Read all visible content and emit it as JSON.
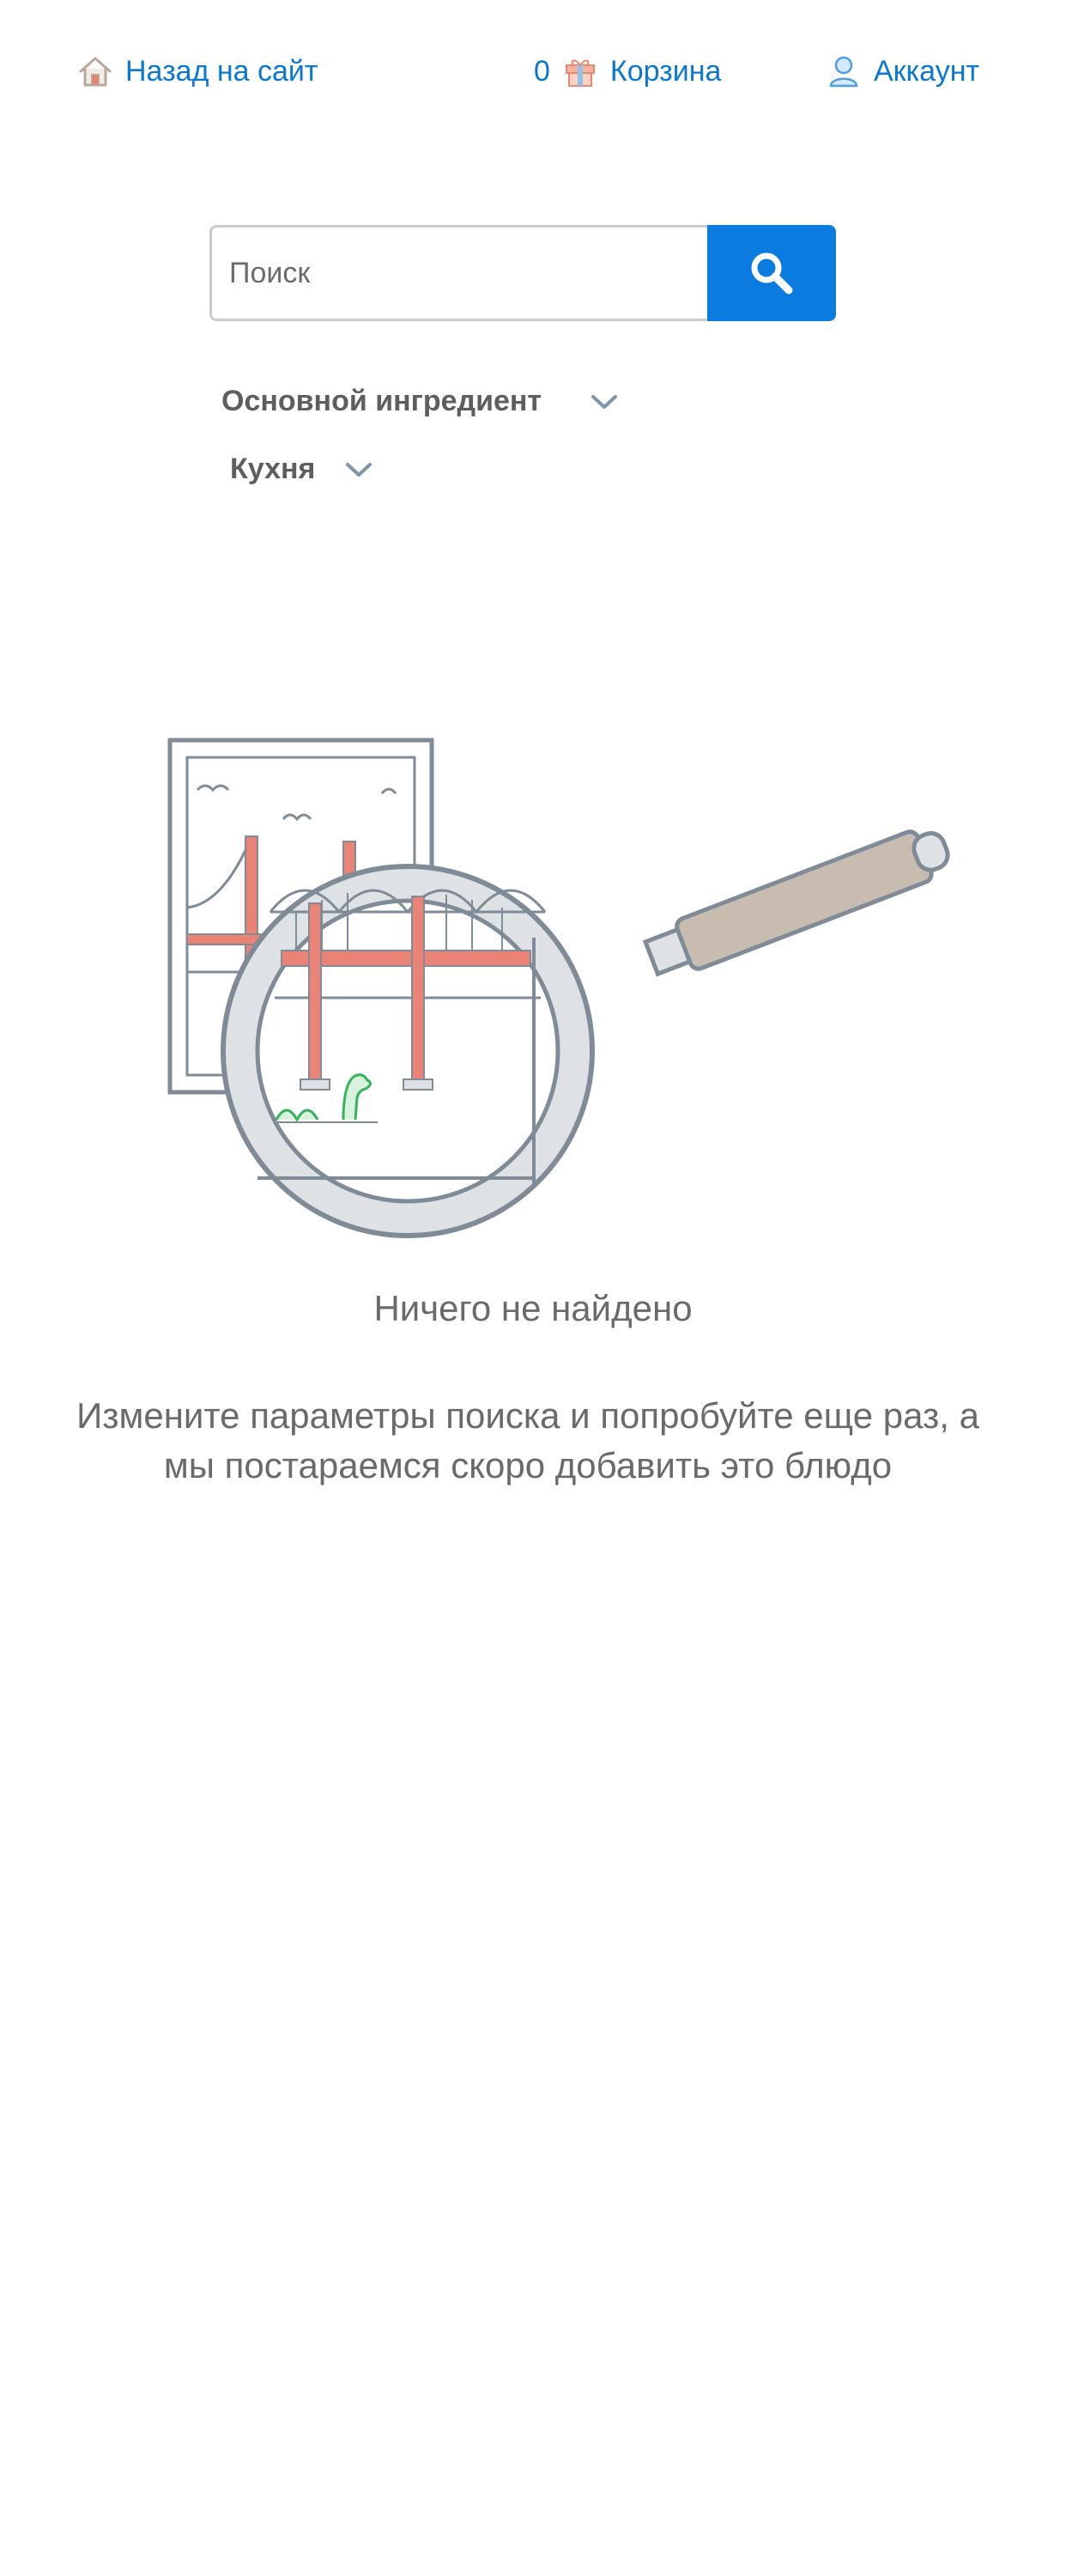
{
  "nav": {
    "back_label": "Назад на сайт",
    "back_icon": "home-icon",
    "cart_count": "0",
    "cart_label": "Корзина",
    "cart_icon": "gift-icon",
    "account_label": "Аккаунт",
    "account_icon": "user-icon",
    "link_color": "#0a77d4"
  },
  "search": {
    "placeholder": "Поиск",
    "value": "",
    "button_icon": "search-icon",
    "button_color": "#0a7bdf"
  },
  "filters": [
    {
      "label": "Основной ингредиент",
      "icon": "chevron-down-icon"
    },
    {
      "label": "Кухня",
      "icon": "chevron-down-icon"
    }
  ],
  "empty_state": {
    "illustration": "magnifying-glass-over-bridge-picture",
    "title": "Ничего не найдено",
    "text": "Измените параметры поиска и попробуйте еще раз, а мы постараемся скоро добавить это блюдо"
  }
}
